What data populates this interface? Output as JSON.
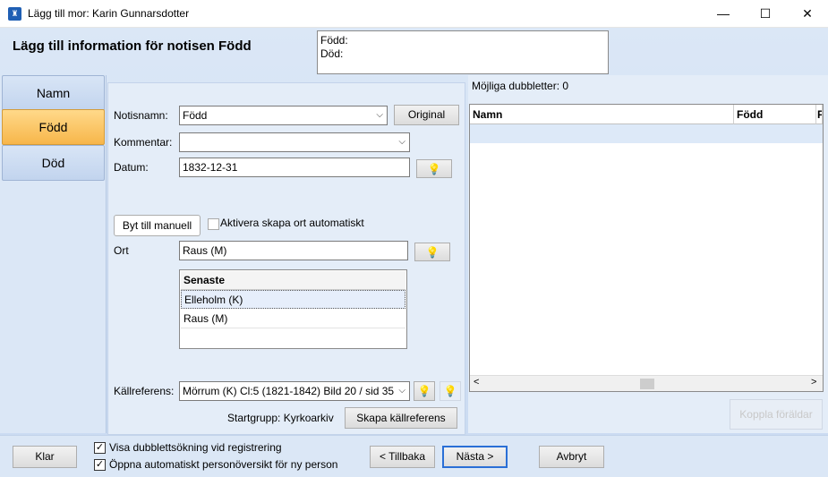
{
  "window": {
    "title": "Lägg till mor: Karin Gunnarsdotter",
    "minimize": "—",
    "maximize": "☐",
    "close": "✕"
  },
  "header": {
    "title": "Lägg till information för notisen Född",
    "summary_line1": "Född:",
    "summary_line2": "Död:"
  },
  "tabs": [
    {
      "label": "Namn"
    },
    {
      "label": "Född"
    },
    {
      "label": "Död"
    }
  ],
  "form": {
    "notisnamn_label": "Notisnamn:",
    "notisnamn_value": "Född",
    "original_button": "Original",
    "kommentar_label": "Kommentar:",
    "kommentar_value": "",
    "datum_label": "Datum:",
    "datum_value": "1832-12-31",
    "byt_button": "Byt till manuell",
    "aktivera_label": "Aktivera skapa ort automatiskt",
    "ort_label": "Ort",
    "ort_value": "Raus (M)",
    "senaste_header": "Senaste",
    "senaste_items": [
      "Elleholm (K)",
      "Raus (M)"
    ],
    "kallref_label": "Källreferens:",
    "kallref_value": "Mörrum (K) Cl:5 (1821-1842) Bild 20 / sid 35 (",
    "startgrupp_text": "Startgrupp: Kyrkoarkiv",
    "skapa_button": "Skapa källreferens"
  },
  "duplicates": {
    "title": "Möjliga dubbletter: 0",
    "columns": [
      "Namn",
      "Född",
      "F"
    ],
    "koppla_button": "Koppla föräldar"
  },
  "footer": {
    "klar_button": "Klar",
    "check1_label": "Visa dubblettsökning vid registrering",
    "check2_label": "Öppna automatiskt personöversikt för ny person",
    "tillbaka_button": "< Tillbaka",
    "nasta_button": "Nästa >",
    "avbryt_button": "Avbryt"
  },
  "colors": {
    "accent": "#2a6fd6",
    "active_tab": "#f7b64a",
    "background": "#dbe7f6"
  }
}
